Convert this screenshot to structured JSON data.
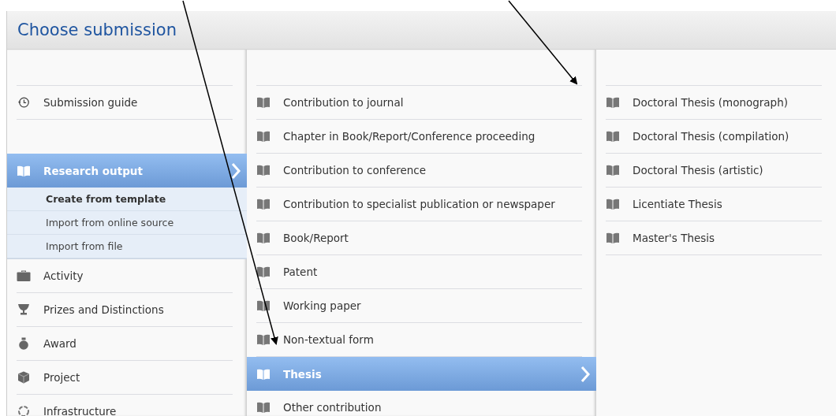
{
  "header": {
    "title": "Choose submission"
  },
  "guide": {
    "label": "Submission guide"
  },
  "categories": [
    {
      "label": "Research output",
      "selected": true,
      "children": [
        {
          "label": "Create from template",
          "selected": true
        },
        {
          "label": "Import from online source",
          "selected": false
        },
        {
          "label": "Import from file",
          "selected": false
        }
      ]
    },
    {
      "label": "Activity",
      "selected": false
    },
    {
      "label": "Prizes and Distinctions",
      "selected": false
    },
    {
      "label": "Award",
      "selected": false
    },
    {
      "label": "Project",
      "selected": false
    },
    {
      "label": "Infrastructure",
      "selected": false
    }
  ],
  "types": [
    {
      "label": "Contribution to journal",
      "selected": false
    },
    {
      "label": "Chapter in Book/Report/Conference proceeding",
      "selected": false
    },
    {
      "label": "Contribution to conference",
      "selected": false
    },
    {
      "label": "Contribution to specialist publication or newspaper",
      "selected": false
    },
    {
      "label": "Book/Report",
      "selected": false
    },
    {
      "label": "Patent",
      "selected": false
    },
    {
      "label": "Working paper",
      "selected": false
    },
    {
      "label": "Non-textual form",
      "selected": false
    },
    {
      "label": "Thesis",
      "selected": true
    },
    {
      "label": "Other contribution",
      "selected": false
    }
  ],
  "subtypes": [
    {
      "label": "Doctoral Thesis (monograph)",
      "selected": false
    },
    {
      "label": "Doctoral Thesis (compilation)",
      "selected": false
    },
    {
      "label": "Doctoral Thesis (artistic)",
      "selected": false
    },
    {
      "label": "Licentiate Thesis",
      "selected": false
    },
    {
      "label": "Master's Thesis",
      "selected": false
    }
  ]
}
